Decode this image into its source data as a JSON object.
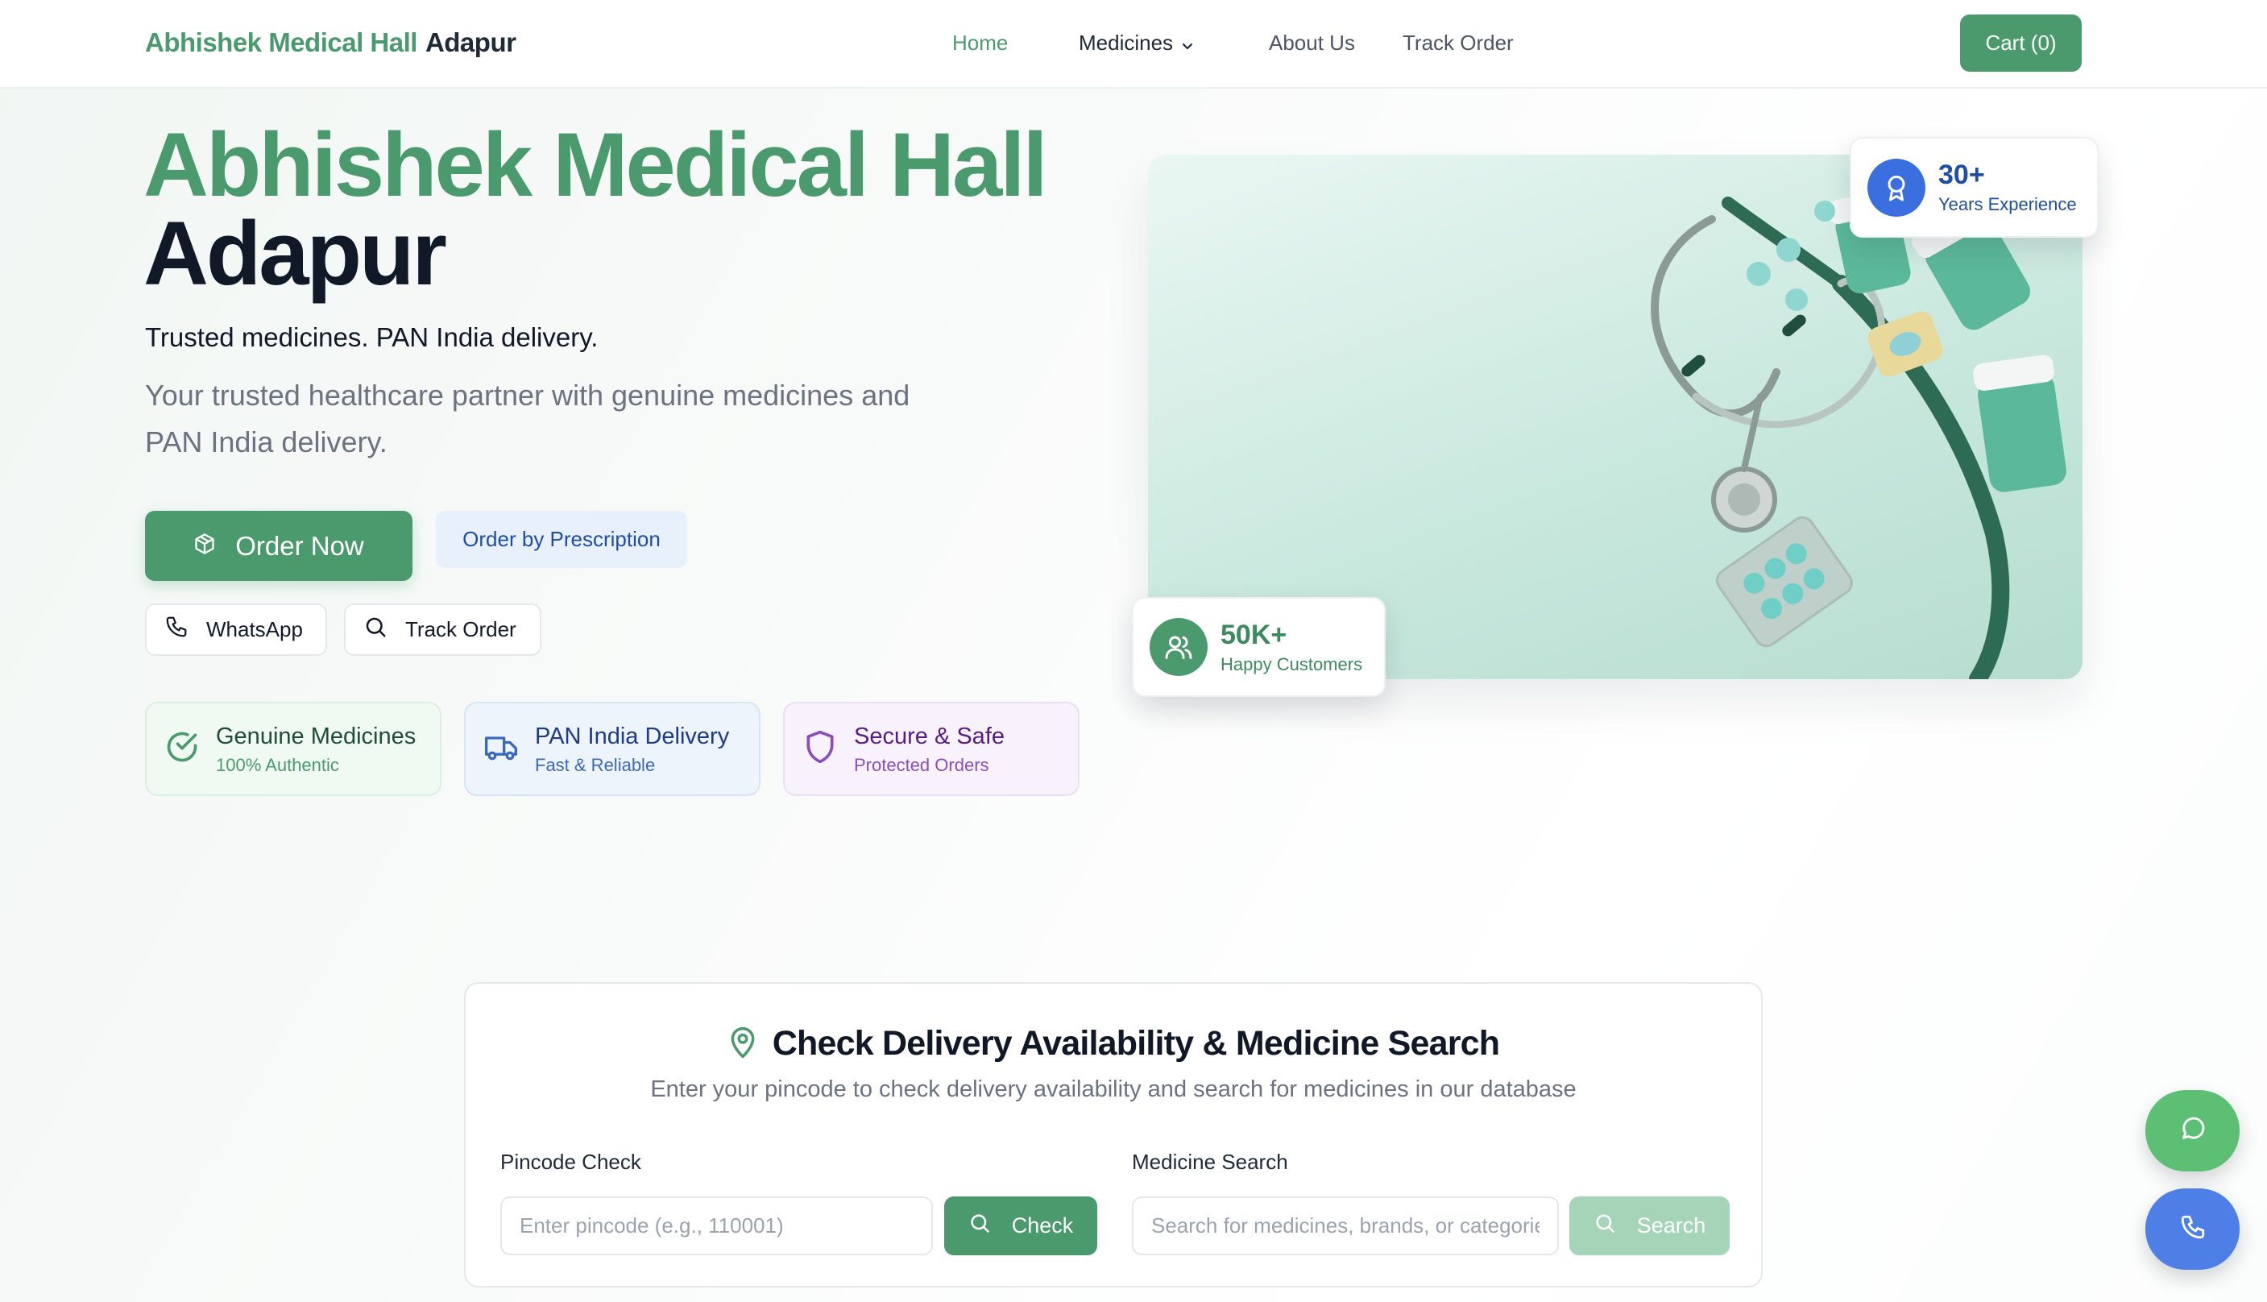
{
  "nav": {
    "brand_primary": "Abhishek Medical Hall",
    "brand_secondary": "Adapur",
    "links": {
      "home": "Home",
      "medicines": "Medicines",
      "about": "About Us",
      "track": "Track Order"
    },
    "cart_label": "Cart (0)"
  },
  "hero": {
    "title_line1": "Abhishek Medical Hall",
    "title_line2": "Adapur",
    "tagline": "Trusted medicines. PAN India delivery.",
    "description": "Your trusted healthcare partner with genuine medicines and PAN India delivery.",
    "order_now_label": "Order Now",
    "prescription_label": "Order by Prescription",
    "whatsapp_label": "WhatsApp",
    "track_label": "Track Order"
  },
  "features": [
    {
      "title": "Genuine Medicines",
      "subtitle": "100% Authentic",
      "icon": "check-circle-icon"
    },
    {
      "title": "PAN India Delivery",
      "subtitle": "Fast & Reliable",
      "icon": "truck-icon"
    },
    {
      "title": "Secure & Safe",
      "subtitle": "Protected Orders",
      "icon": "shield-icon"
    }
  ],
  "stats": {
    "experience": {
      "value": "30+",
      "label": "Years Experience",
      "icon": "award-icon"
    },
    "customers": {
      "value": "50K+",
      "label": "Happy Customers",
      "icon": "users-icon"
    }
  },
  "search_section": {
    "title": "Check Delivery Availability & Medicine Search",
    "subtitle": "Enter your pincode to check delivery availability and search for medicines in our database",
    "pincode_label": "Pincode Check",
    "pincode_placeholder": "Enter pincode (e.g., 110001)",
    "pincode_button": "Check",
    "medicine_label": "Medicine Search",
    "medicine_placeholder": "Search for medicines, brands, or categories",
    "medicine_button": "Search"
  },
  "colors": {
    "brand_green": "#4a9a6e",
    "accent_blue": "#3b6fe0",
    "whatsapp_fab": "#5cbf74",
    "call_fab": "#4d7fe6"
  }
}
